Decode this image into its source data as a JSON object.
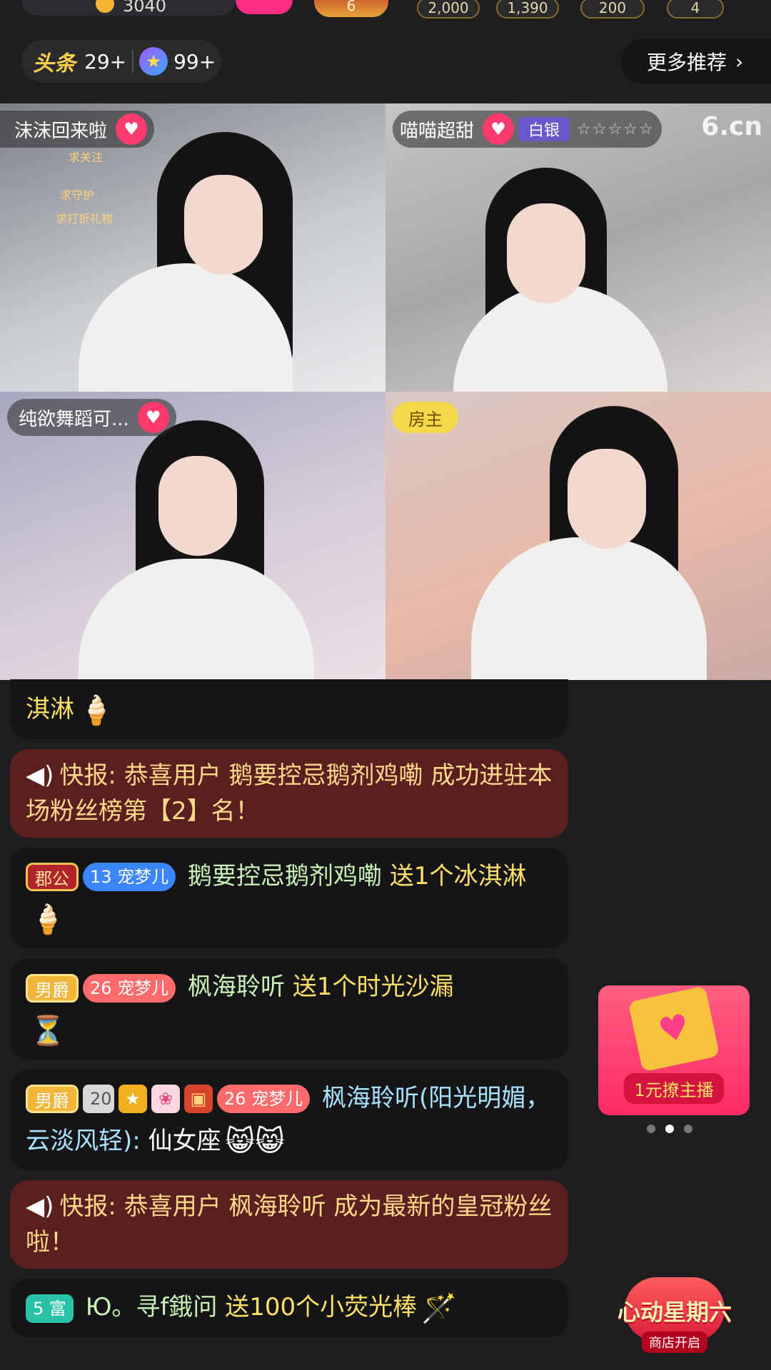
{
  "top_bar": {
    "coin_value": "3040",
    "crown_level": "6",
    "gift_counts": [
      "2,000",
      "1,390",
      "200",
      "4"
    ]
  },
  "headline": {
    "logo": "头条",
    "headline_count": "29+",
    "star_count": "99+"
  },
  "more_recommend": {
    "label": "更多推荐",
    "chevron": "chevron-right-icon"
  },
  "streams": [
    {
      "name": "沫沫回来啦",
      "overlay_lines": [
        "求关注",
        "求守护",
        "求打折礼物"
      ]
    },
    {
      "name": "喵喵超甜",
      "rank": "白银",
      "stars": "☆☆☆☆☆",
      "watermark": "6.cn"
    },
    {
      "name": "纯欲舞蹈可..."
    },
    {
      "owner_label": "房主"
    }
  ],
  "chat": {
    "msg0": {
      "text": "淇淋",
      "emoji": "🍦"
    },
    "msg1": {
      "prefix": "快报:",
      "text": "恭喜用户 鹅要控忌鹅剂鸡嘞 成功进驻本场粉丝榜第【2】名！"
    },
    "msg2": {
      "title_badge": "郡公",
      "pet_level": "13",
      "pet_badge": "宠梦儿",
      "user": "鹅要控忌鹅剂鸡嘞",
      "action": "送1个冰淇淋",
      "emoji": "🍦"
    },
    "msg3": {
      "title_badge": "男爵",
      "pet_level": "26",
      "pet_badge": "宠梦儿",
      "user": "枫海聆听",
      "action": "送1个时光沙漏",
      "emoji": "⏳"
    },
    "msg4": {
      "title_badge": "男爵",
      "guard_badge": "20",
      "pet_level": "26",
      "pet_badge": "宠梦儿",
      "user": "枫海聆听(阳光明媚，云淡风轻):",
      "text": "仙女座",
      "emoji": "😸😸"
    },
    "msg5": {
      "prefix": "快报:",
      "text": "恭喜用户 枫海聆听 成为最新的皇冠粉丝啦！"
    },
    "msg6": {
      "rich_badge": "5 富",
      "user": "Ю。寻f鋨问",
      "action": "送100个小荧光棒",
      "emoji": "🪄"
    }
  },
  "promo": {
    "label": "1元撩主播",
    "card_icon": "heart-icon"
  },
  "carousel_dots": 3,
  "event": {
    "title": "心动星期六",
    "subtitle": "商店开启"
  }
}
